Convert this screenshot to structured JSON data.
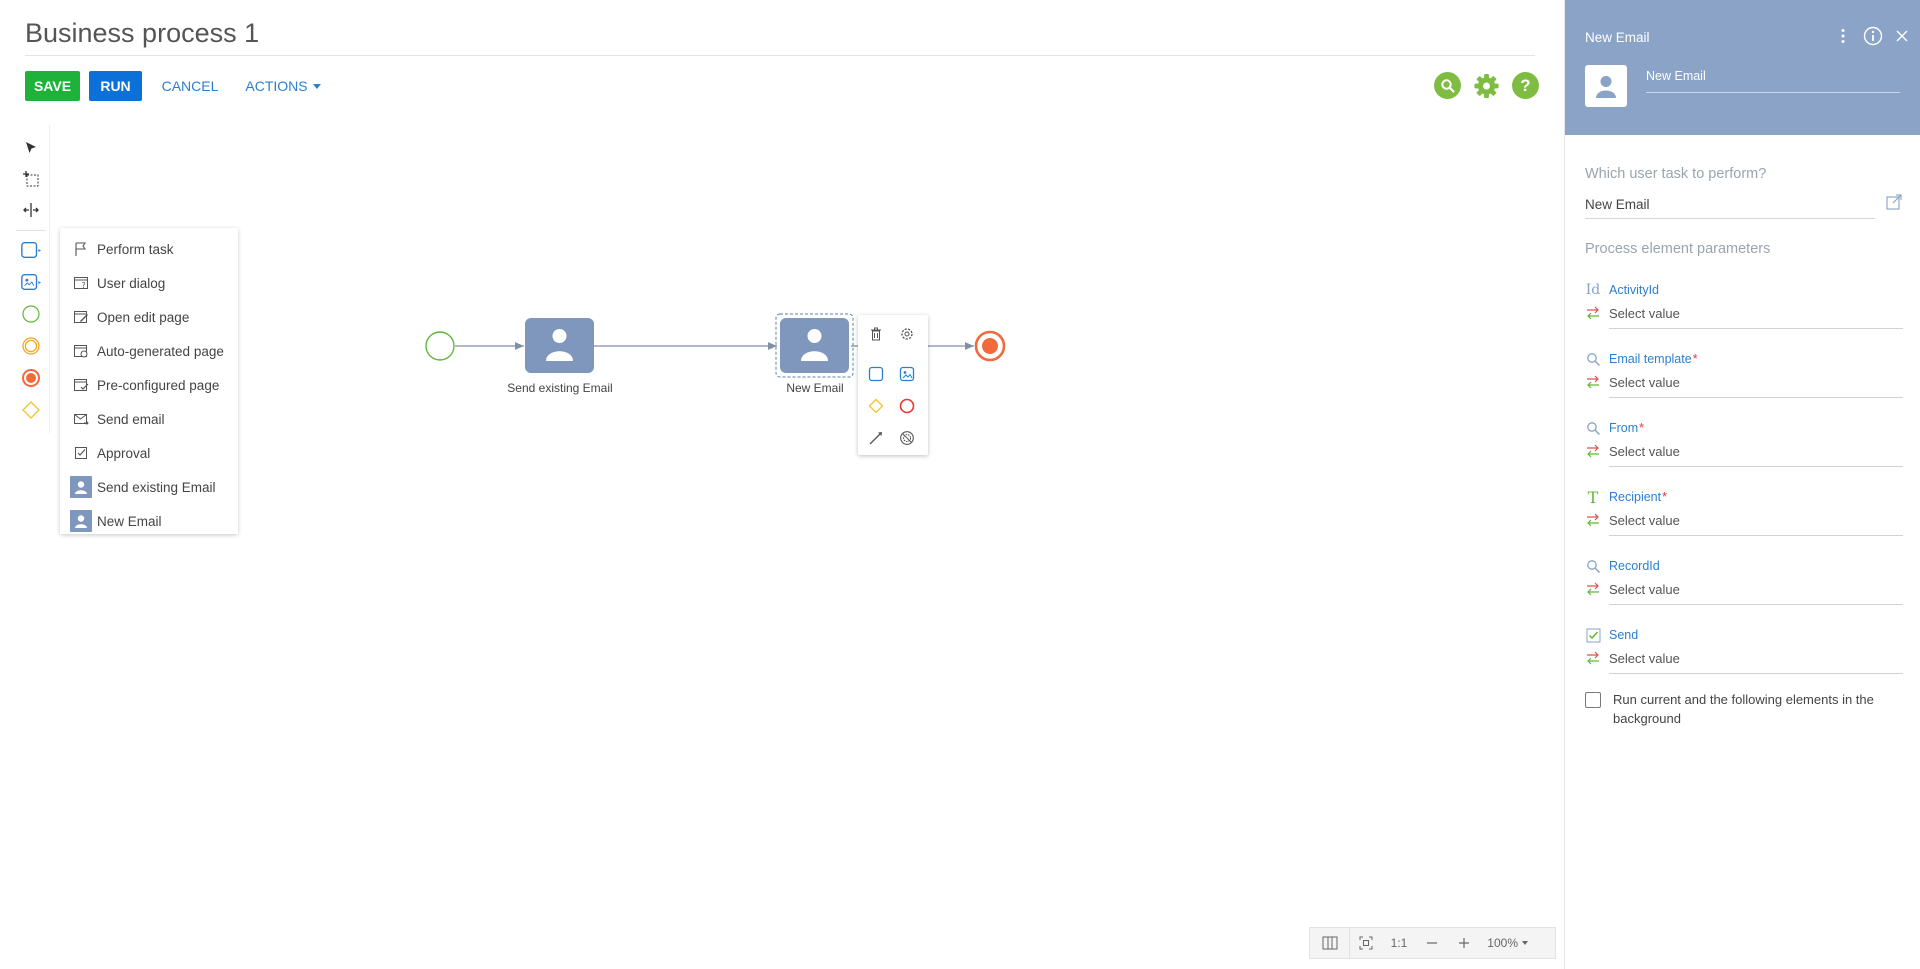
{
  "header": {
    "title": "Business process 1",
    "save_label": "SAVE",
    "run_label": "RUN",
    "cancel_label": "CANCEL",
    "actions_label": "ACTIONS",
    "icons": [
      "search-icon",
      "settings-gear-icon",
      "help-icon"
    ],
    "accent_green": "#7fbd42"
  },
  "toolbar": {
    "tools": [
      "pointer-icon",
      "lasso-select-icon",
      "space-tool-icon",
      "task-shape-icon",
      "user-task-icon",
      "start-event-icon",
      "intermediate-event-icon",
      "end-event-icon",
      "gateway-icon"
    ]
  },
  "dropdown": {
    "items": [
      {
        "label": "Perform task",
        "icon": "flag-icon"
      },
      {
        "label": "User dialog",
        "icon": "dialog-icon"
      },
      {
        "label": "Open edit page",
        "icon": "edit-page-icon"
      },
      {
        "label": "Auto-generated page",
        "icon": "auto-page-icon"
      },
      {
        "label": "Pre-configured page",
        "icon": "preconfigured-page-icon"
      },
      {
        "label": "Send email",
        "icon": "send-email-icon"
      },
      {
        "label": "Approval",
        "icon": "approval-icon"
      },
      {
        "label": "Send existing Email",
        "icon": "user-avatar-icon"
      },
      {
        "label": "New Email",
        "icon": "user-avatar-icon"
      }
    ]
  },
  "canvas": {
    "nodes": [
      {
        "label": "Send existing Email"
      },
      {
        "label": "New Email"
      }
    ],
    "task_color": "#7f97bc",
    "start_color": "#5fb83a",
    "end_color": "#f16a3b"
  },
  "zoom": {
    "ratio_label": "1:1",
    "level": "100%"
  },
  "panel": {
    "title": "New Email",
    "element_name": "New Email",
    "header_color": "#8aa3c6",
    "question_label": "Which user task to perform?",
    "question_value": "New Email",
    "section_label": "Process element parameters",
    "params": [
      {
        "name": "ActivityId",
        "required": false,
        "value": "Select value",
        "icon": "id-icon"
      },
      {
        "name": "Email template",
        "required": true,
        "value": "Select value",
        "icon": "lookup-icon"
      },
      {
        "name": "From",
        "required": true,
        "value": "Select value",
        "icon": "lookup-icon"
      },
      {
        "name": "Recipient",
        "required": true,
        "value": "Select value",
        "icon": "text-icon"
      },
      {
        "name": "RecordId",
        "required": false,
        "value": "Select value",
        "icon": "lookup-icon"
      },
      {
        "name": "Send",
        "required": false,
        "value": "Select value",
        "icon": "checkbox-icon"
      }
    ],
    "required_mark": "*",
    "background_label": "Run current and the following elements in the background"
  }
}
